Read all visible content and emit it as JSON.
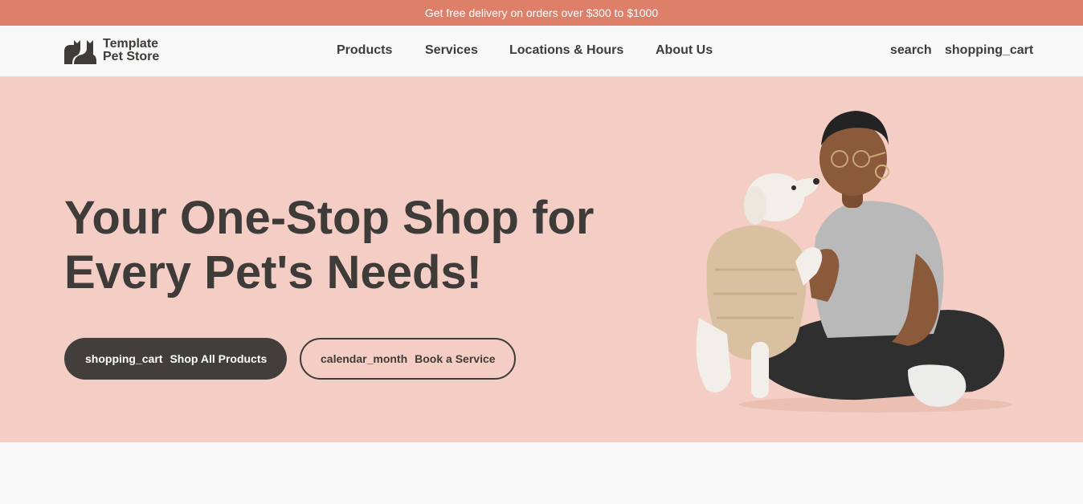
{
  "promo": {
    "text": "Get free delivery on orders over $300 to $1000"
  },
  "header": {
    "logo": {
      "line1": "Template",
      "line2": "Pet Store"
    },
    "nav": [
      {
        "label": "Products"
      },
      {
        "label": "Services"
      },
      {
        "label": "Locations & Hours"
      },
      {
        "label": "About Us"
      }
    ],
    "actions": {
      "search": "search",
      "cart": "shopping_cart"
    }
  },
  "hero": {
    "title": "Your One-Stop Shop for Every Pet's Needs!",
    "primary_button": {
      "icon": "shopping_cart",
      "label": "Shop All Products"
    },
    "secondary_button": {
      "icon": "calendar_month",
      "label": "Book a Service"
    },
    "illustration": "person-with-dog-in-sweater"
  },
  "colors": {
    "promo_bg": "#de8069",
    "hero_bg": "#f4cec4",
    "text_dark": "#3f3b39",
    "page_bg": "#f8f8f8"
  }
}
